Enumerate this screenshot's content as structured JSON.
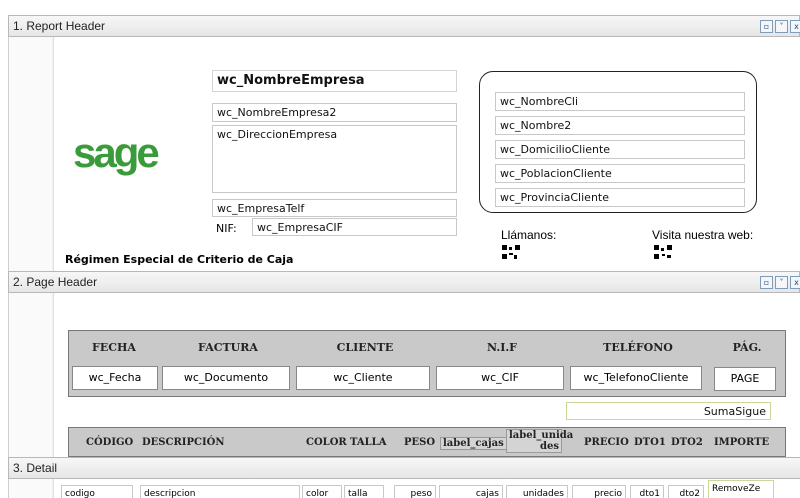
{
  "bands": {
    "report_header": "1. Report Header",
    "page_header": "2. Page Header",
    "detail": "3. Detail"
  },
  "band_buttons": [
    "▫",
    "˅",
    "x"
  ],
  "report_header": {
    "logo": "sage",
    "empresa_nombre": "wc_NombreEmpresa",
    "empresa_nombre2": "wc_NombreEmpresa2",
    "empresa_direccion": "wc_DireccionEmpresa",
    "empresa_telf": "wc_EmpresaTelf",
    "nif_label": "NIF:",
    "empresa_cif": "wc_EmpresaCIF",
    "regimen": "Régimen Especial de Criterio de Caja",
    "cliente": [
      "wc_NombreCli",
      "wc_Nombre2",
      "wc_DomicilioCliente",
      "wc_PoblacionCliente",
      "wc_ProvinciaCliente"
    ],
    "llamanos": "Llámanos:",
    "visita": "Visita nuestra web:"
  },
  "page_header": {
    "headers": [
      "FECHA",
      "FACTURA",
      "CLIENTE",
      "N.I.F",
      "TELÉFONO",
      "PÁG."
    ],
    "values": [
      "wc_Fecha",
      "wc_Documento",
      "wc_Cliente",
      "wc_CIF",
      "wc_TelefonoCliente",
      "PAGE"
    ],
    "suma_sigue": "SumaSigue",
    "columns": [
      "CÓDIGO",
      "DESCRIPCIÓN",
      "COLOR",
      "TALLA",
      "PESO",
      "label_cajas",
      "label_unida des",
      "PRECIO",
      "DTO1",
      "DTO2",
      "IMPORTE"
    ]
  },
  "detail": {
    "fields": [
      "codigo",
      "descripcion",
      "color",
      "talla",
      "peso",
      "cajas",
      "unidades",
      "precio",
      "dto1",
      "dto2",
      "RemoveZe"
    ]
  },
  "colors": {
    "logo": "#3a9b3a",
    "header_fill": "#c9c9c9",
    "suma_border": "#c8d89a"
  }
}
